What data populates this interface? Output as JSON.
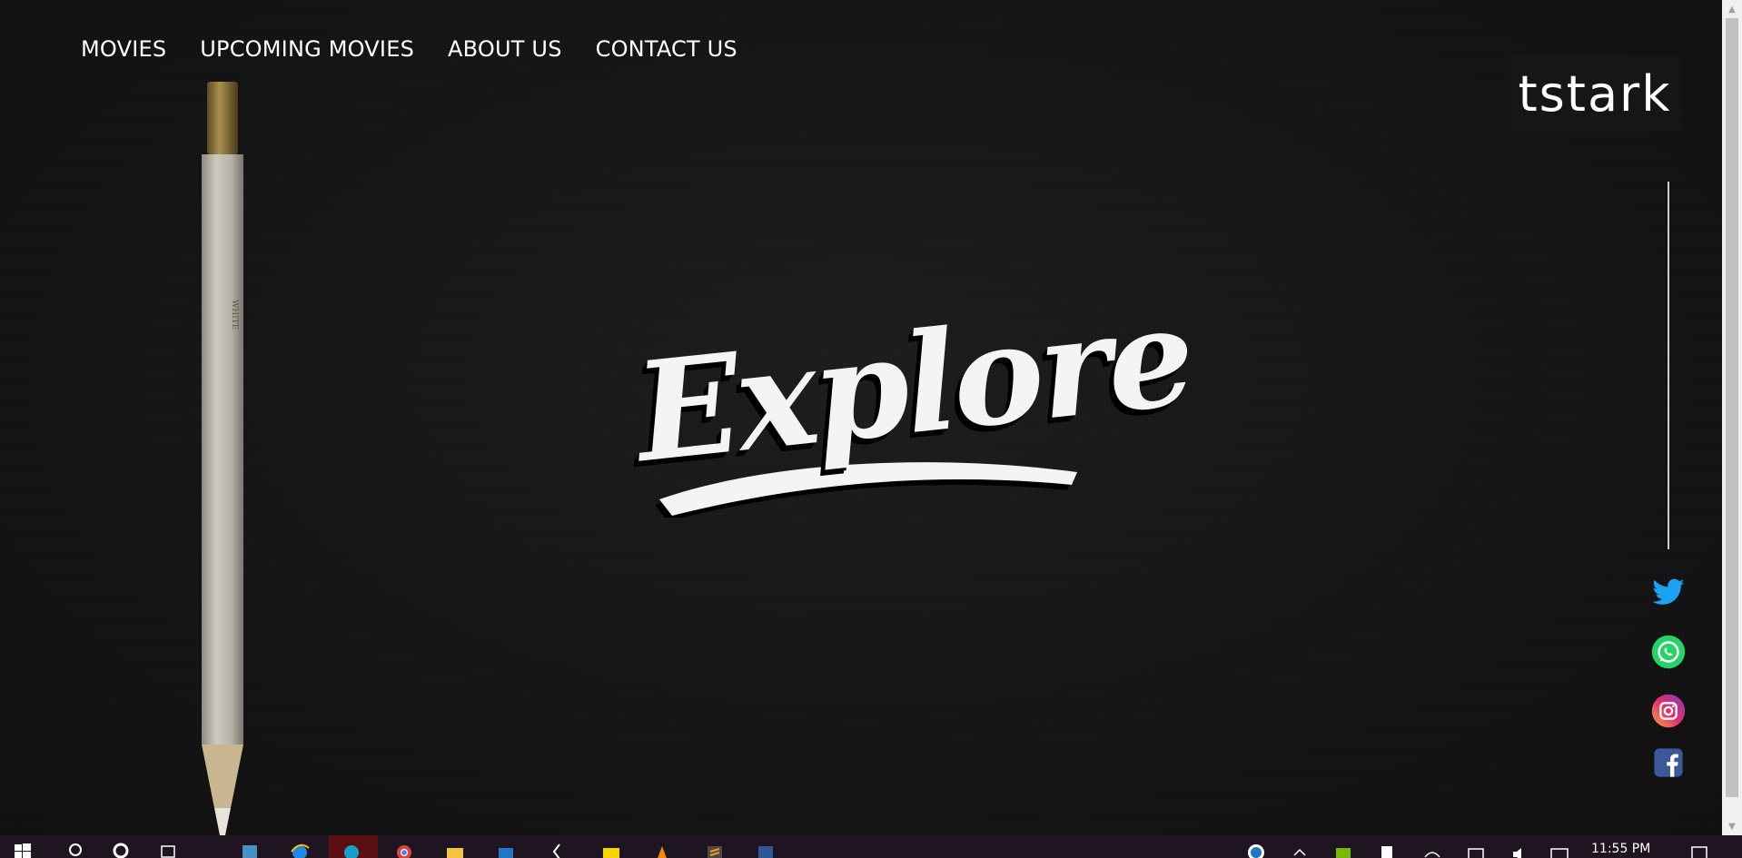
{
  "nav": {
    "items": [
      {
        "label": "MOVIES"
      },
      {
        "label": "UPCOMING MOVIES"
      },
      {
        "label": "ABOUT US"
      },
      {
        "label": "CONTACT US"
      }
    ]
  },
  "logo": {
    "text": "tstark"
  },
  "hero": {
    "text": "Explore"
  },
  "pencil": {
    "imprint": "WHITE"
  },
  "social": [
    {
      "name": "twitter",
      "color": "#1da1f2"
    },
    {
      "name": "whatsapp",
      "color": "#25d366"
    },
    {
      "name": "instagram",
      "color": "#e1306c"
    },
    {
      "name": "facebook",
      "color": "#3b5998"
    }
  ],
  "taskbar": {
    "clock": "11:55 PM",
    "icons": [
      "windows-start",
      "search",
      "cortana",
      "task-view",
      "app",
      "internet-explorer",
      "edge",
      "chrome",
      "file-explorer",
      "mail",
      "vs-code",
      "sticky-notes",
      "vlc",
      "sublime-text",
      "word"
    ]
  },
  "colors": {
    "background": "#121212",
    "accent": "#ffffff",
    "taskbar": "#1f1520"
  }
}
